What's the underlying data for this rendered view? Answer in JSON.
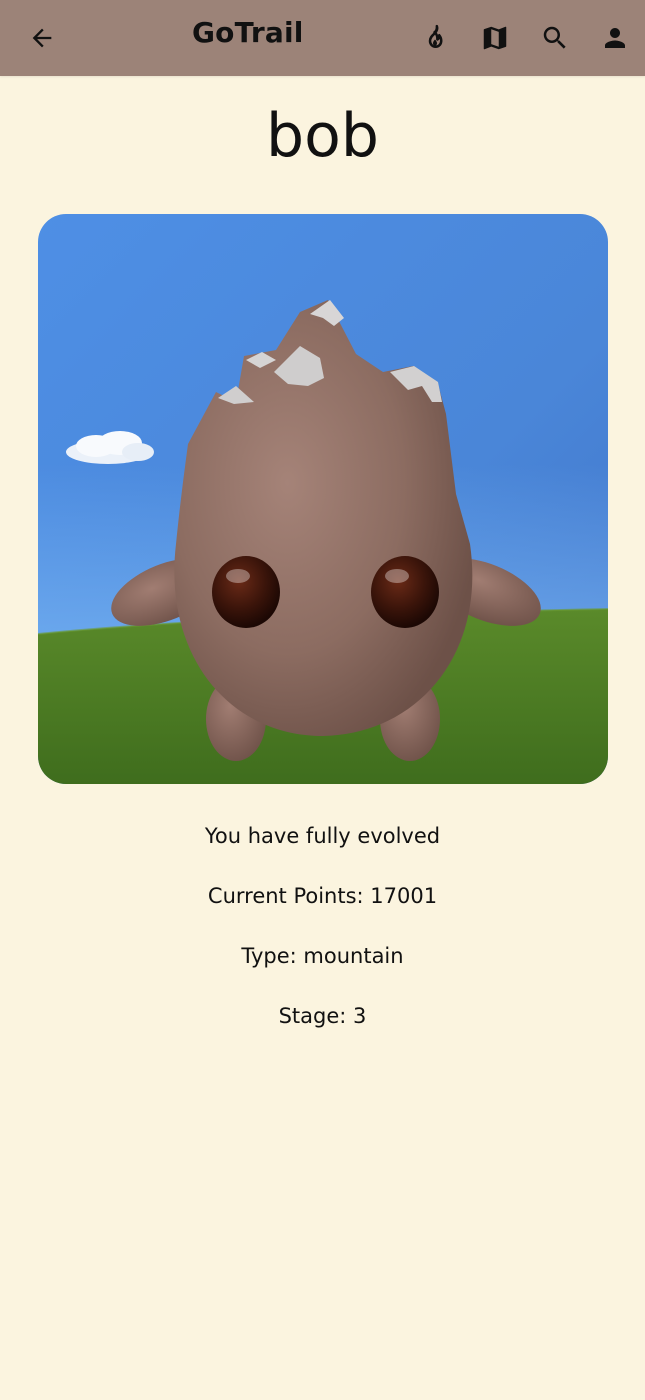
{
  "app_bar": {
    "title": "GoTrail",
    "back_icon": "arrow-left-icon",
    "actions": [
      {
        "name": "streak-button",
        "icon": "flame-icon"
      },
      {
        "name": "map-button",
        "icon": "map-icon"
      },
      {
        "name": "search-button",
        "icon": "search-icon"
      },
      {
        "name": "profile-button",
        "icon": "person-icon"
      }
    ]
  },
  "pet": {
    "name": "bob",
    "evolution_status": "You have fully evolved",
    "points_text": "Current Points: 17001",
    "type_text": "Type: mountain",
    "stage_text": "Stage: 3"
  },
  "colors": {
    "background": "#fbf4df",
    "app_bar": "#9c8378",
    "text": "#111111",
    "sky": "#4a86d8",
    "grass": "#4f7d25",
    "creature": "#8a6b61"
  }
}
